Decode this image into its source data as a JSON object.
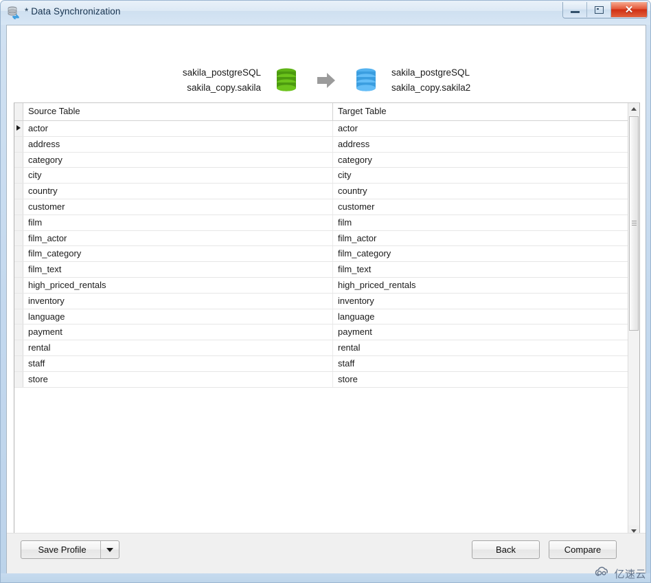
{
  "window": {
    "title": "* Data Synchronization",
    "icon": "database-sync-icon",
    "controls": {
      "minimize": "minimize-button",
      "maximize": "maximize-button",
      "close": "close-button"
    }
  },
  "summary": {
    "source": {
      "connection": "sakila_postgreSQL",
      "schema": "sakila_copy.sakila",
      "icon": "database-icon",
      "color": "#4c9a0f"
    },
    "arrow": "arrow-right-icon",
    "target": {
      "connection": "sakila_postgreSQL",
      "schema": "sakila_copy.sakila2",
      "icon": "database-icon",
      "color": "#3b9ee0"
    }
  },
  "grid": {
    "columns": [
      "Source Table",
      "Target Table"
    ],
    "current_row_index": 0,
    "rows": [
      {
        "source": "actor",
        "target": "actor"
      },
      {
        "source": "address",
        "target": "address"
      },
      {
        "source": "category",
        "target": "category"
      },
      {
        "source": "city",
        "target": "city"
      },
      {
        "source": "country",
        "target": "country"
      },
      {
        "source": "customer",
        "target": "customer"
      },
      {
        "source": "film",
        "target": "film"
      },
      {
        "source": "film_actor",
        "target": "film_actor"
      },
      {
        "source": "film_category",
        "target": "film_category"
      },
      {
        "source": "film_text",
        "target": "film_text"
      },
      {
        "source": "high_priced_rentals",
        "target": "high_priced_rentals"
      },
      {
        "source": "inventory",
        "target": "inventory"
      },
      {
        "source": "language",
        "target": "language"
      },
      {
        "source": "payment",
        "target": "payment"
      },
      {
        "source": "rental",
        "target": "rental"
      },
      {
        "source": "staff",
        "target": "staff"
      },
      {
        "source": "store",
        "target": "store"
      }
    ]
  },
  "footer": {
    "save_profile": "Save Profile",
    "back": "Back",
    "compare": "Compare"
  },
  "watermark": {
    "text": "亿速云",
    "icon": "cloud-logo-icon"
  }
}
